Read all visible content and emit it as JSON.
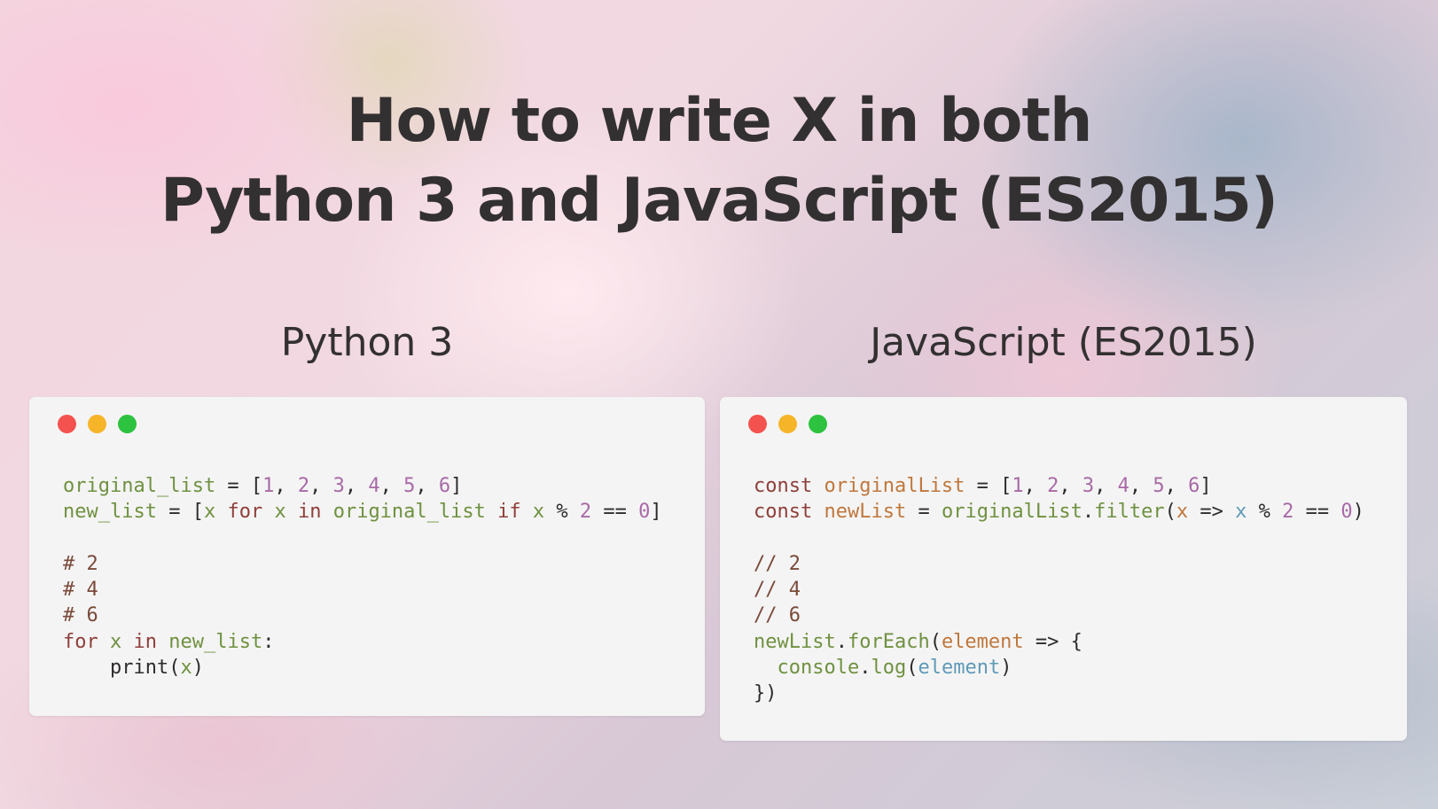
{
  "title": {
    "line1": "How to write X in both",
    "line2": "Python 3 and JavaScript (ES2015)"
  },
  "columns": {
    "left_heading": "Python 3",
    "right_heading": "JavaScript (ES2015)"
  },
  "colors": {
    "window_background": "#f4f4f4",
    "close_dot": "#f4524e",
    "minimize_dot": "#f6b429",
    "maximize_dot": "#2dc23f",
    "keyword": "#8f3f3a",
    "identifier": "#6f9140",
    "number": "#a86aa6",
    "comment": "#7a4a3a",
    "js_variable": "#c0773c",
    "js_param": "#5f9ab8"
  },
  "icons": [
    "close-dot-icon",
    "minimize-dot-icon",
    "maximize-dot-icon"
  ],
  "python": {
    "lines": [
      [
        {
          "t": "original_list",
          "c": "id"
        },
        {
          "t": " = [",
          "c": "op"
        },
        {
          "t": "1",
          "c": "num"
        },
        {
          "t": ", ",
          "c": "op"
        },
        {
          "t": "2",
          "c": "num"
        },
        {
          "t": ", ",
          "c": "op"
        },
        {
          "t": "3",
          "c": "num"
        },
        {
          "t": ", ",
          "c": "op"
        },
        {
          "t": "4",
          "c": "num"
        },
        {
          "t": ", ",
          "c": "op"
        },
        {
          "t": "5",
          "c": "num"
        },
        {
          "t": ", ",
          "c": "op"
        },
        {
          "t": "6",
          "c": "num"
        },
        {
          "t": "]",
          "c": "op"
        }
      ],
      [
        {
          "t": "new_list",
          "c": "id"
        },
        {
          "t": " = [",
          "c": "op"
        },
        {
          "t": "x",
          "c": "id"
        },
        {
          "t": " ",
          "c": "op"
        },
        {
          "t": "for",
          "c": "kw"
        },
        {
          "t": " ",
          "c": "op"
        },
        {
          "t": "x",
          "c": "id"
        },
        {
          "t": " ",
          "c": "op"
        },
        {
          "t": "in",
          "c": "kw"
        },
        {
          "t": " ",
          "c": "op"
        },
        {
          "t": "original_list",
          "c": "id"
        },
        {
          "t": " ",
          "c": "op"
        },
        {
          "t": "if",
          "c": "kw"
        },
        {
          "t": " ",
          "c": "op"
        },
        {
          "t": "x",
          "c": "id"
        },
        {
          "t": " % ",
          "c": "op"
        },
        {
          "t": "2",
          "c": "num"
        },
        {
          "t": " == ",
          "c": "op"
        },
        {
          "t": "0",
          "c": "num"
        },
        {
          "t": "]",
          "c": "op"
        }
      ],
      [],
      [
        {
          "t": "# 2",
          "c": "cm"
        }
      ],
      [
        {
          "t": "# 4",
          "c": "cm"
        }
      ],
      [
        {
          "t": "# 6",
          "c": "cm"
        }
      ],
      [
        {
          "t": "for",
          "c": "kw"
        },
        {
          "t": " ",
          "c": "op"
        },
        {
          "t": "x",
          "c": "id"
        },
        {
          "t": " ",
          "c": "op"
        },
        {
          "t": "in",
          "c": "kw"
        },
        {
          "t": " ",
          "c": "op"
        },
        {
          "t": "new_list",
          "c": "id"
        },
        {
          "t": ":",
          "c": "op"
        }
      ],
      [
        {
          "t": "    print(",
          "c": "op"
        },
        {
          "t": "x",
          "c": "id"
        },
        {
          "t": ")",
          "c": "op"
        }
      ]
    ]
  },
  "javascript": {
    "lines": [
      [
        {
          "t": "const",
          "c": "kw"
        },
        {
          "t": " ",
          "c": "op"
        },
        {
          "t": "originalList",
          "c": "or"
        },
        {
          "t": " = [",
          "c": "op"
        },
        {
          "t": "1",
          "c": "num"
        },
        {
          "t": ", ",
          "c": "op"
        },
        {
          "t": "2",
          "c": "num"
        },
        {
          "t": ", ",
          "c": "op"
        },
        {
          "t": "3",
          "c": "num"
        },
        {
          "t": ", ",
          "c": "op"
        },
        {
          "t": "4",
          "c": "num"
        },
        {
          "t": ", ",
          "c": "op"
        },
        {
          "t": "5",
          "c": "num"
        },
        {
          "t": ", ",
          "c": "op"
        },
        {
          "t": "6",
          "c": "num"
        },
        {
          "t": "]",
          "c": "op"
        }
      ],
      [
        {
          "t": "const",
          "c": "kw"
        },
        {
          "t": " ",
          "c": "op"
        },
        {
          "t": "newList",
          "c": "or"
        },
        {
          "t": " = ",
          "c": "op"
        },
        {
          "t": "originalList",
          "c": "id"
        },
        {
          "t": ".",
          "c": "op"
        },
        {
          "t": "filter",
          "c": "id"
        },
        {
          "t": "(",
          "c": "op"
        },
        {
          "t": "x",
          "c": "or"
        },
        {
          "t": " => ",
          "c": "op"
        },
        {
          "t": "x",
          "c": "bl"
        },
        {
          "t": " % ",
          "c": "op"
        },
        {
          "t": "2",
          "c": "num"
        },
        {
          "t": " == ",
          "c": "op"
        },
        {
          "t": "0",
          "c": "num"
        },
        {
          "t": ")",
          "c": "op"
        }
      ],
      [],
      [
        {
          "t": "// 2",
          "c": "cm"
        }
      ],
      [
        {
          "t": "// 4",
          "c": "cm"
        }
      ],
      [
        {
          "t": "// 6",
          "c": "cm"
        }
      ],
      [
        {
          "t": "newList",
          "c": "id"
        },
        {
          "t": ".",
          "c": "op"
        },
        {
          "t": "forEach",
          "c": "id"
        },
        {
          "t": "(",
          "c": "op"
        },
        {
          "t": "element",
          "c": "or"
        },
        {
          "t": " => {",
          "c": "op"
        }
      ],
      [
        {
          "t": "  ",
          "c": "op"
        },
        {
          "t": "console",
          "c": "id"
        },
        {
          "t": ".",
          "c": "op"
        },
        {
          "t": "log",
          "c": "id"
        },
        {
          "t": "(",
          "c": "op"
        },
        {
          "t": "element",
          "c": "bl"
        },
        {
          "t": ")",
          "c": "op"
        }
      ],
      [
        {
          "t": "})",
          "c": "op"
        }
      ]
    ]
  }
}
